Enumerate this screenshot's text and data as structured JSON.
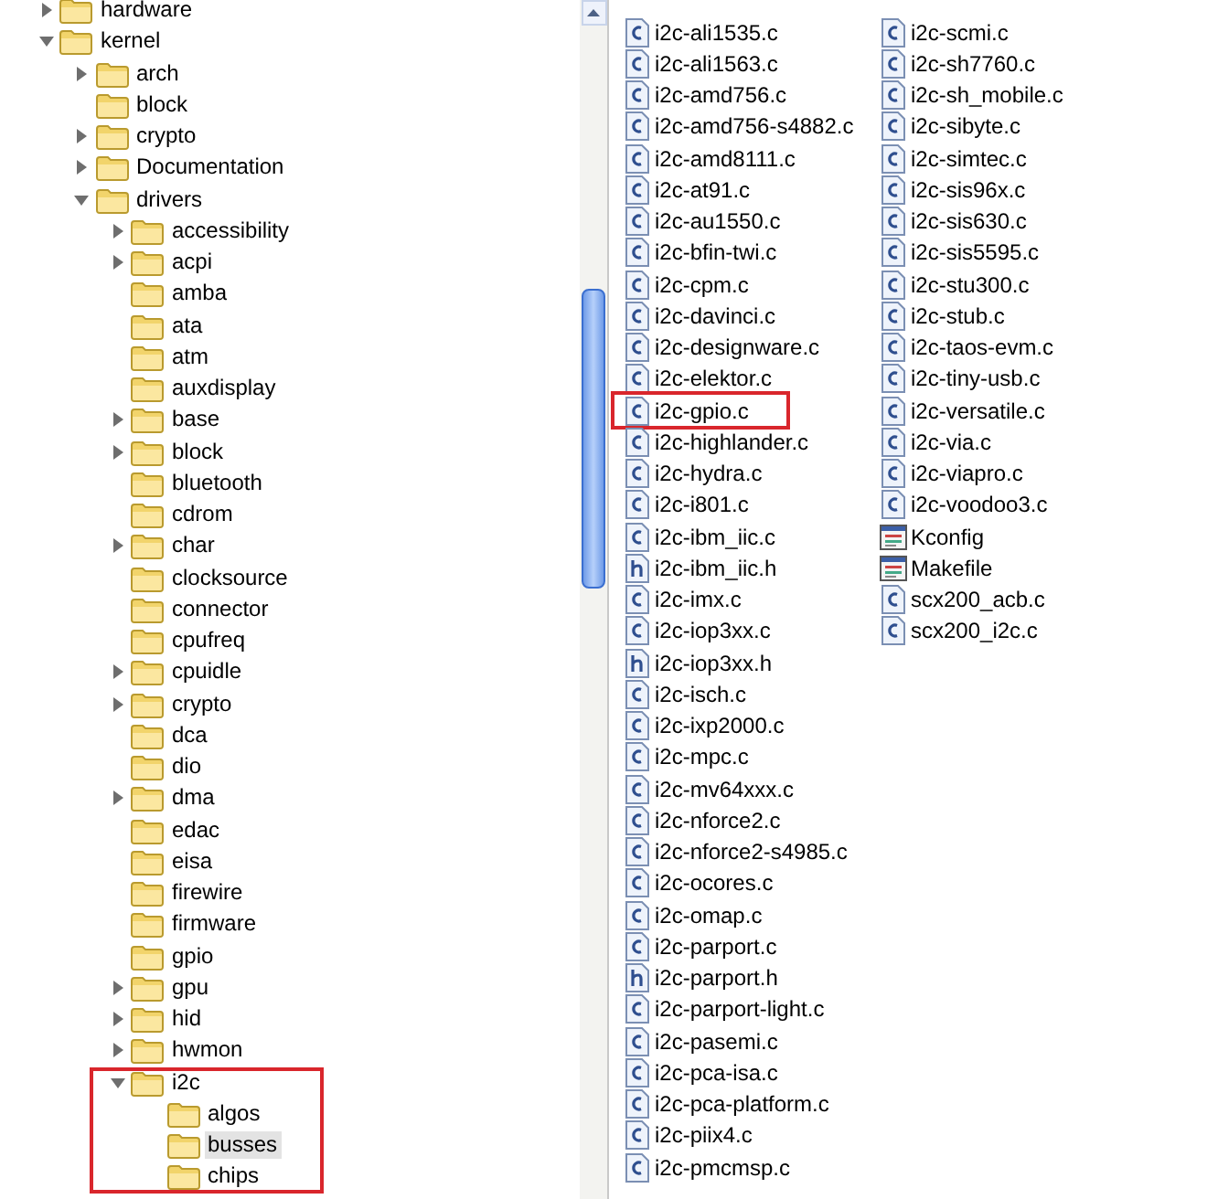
{
  "folder_tree": [
    {
      "label": "hardware",
      "expandable": true,
      "expanded": false,
      "selected": false,
      "outlined": false
    },
    {
      "label": "kernel",
      "expandable": true,
      "expanded": true,
      "selected": false,
      "outlined": false,
      "children": [
        {
          "label": "arch",
          "expandable": true,
          "expanded": false,
          "selected": false,
          "outlined": false
        },
        {
          "label": "block",
          "expandable": false,
          "selected": false,
          "outlined": false
        },
        {
          "label": "crypto",
          "expandable": true,
          "expanded": false,
          "selected": false,
          "outlined": false
        },
        {
          "label": "Documentation",
          "expandable": true,
          "expanded": false,
          "selected": false,
          "outlined": false
        },
        {
          "label": "drivers",
          "expandable": true,
          "expanded": true,
          "selected": false,
          "outlined": false,
          "children": [
            {
              "label": "accessibility",
              "expandable": true,
              "expanded": false,
              "selected": false,
              "outlined": false
            },
            {
              "label": "acpi",
              "expandable": true,
              "expanded": false,
              "selected": false,
              "outlined": false
            },
            {
              "label": "amba",
              "expandable": false,
              "selected": false,
              "outlined": false
            },
            {
              "label": "ata",
              "expandable": false,
              "selected": false,
              "outlined": false
            },
            {
              "label": "atm",
              "expandable": false,
              "selected": false,
              "outlined": false
            },
            {
              "label": "auxdisplay",
              "expandable": false,
              "selected": false,
              "outlined": false
            },
            {
              "label": "base",
              "expandable": true,
              "expanded": false,
              "selected": false,
              "outlined": false
            },
            {
              "label": "block",
              "expandable": true,
              "expanded": false,
              "selected": false,
              "outlined": false
            },
            {
              "label": "bluetooth",
              "expandable": false,
              "selected": false,
              "outlined": false
            },
            {
              "label": "cdrom",
              "expandable": false,
              "selected": false,
              "outlined": false
            },
            {
              "label": "char",
              "expandable": true,
              "expanded": false,
              "selected": false,
              "outlined": false
            },
            {
              "label": "clocksource",
              "expandable": false,
              "selected": false,
              "outlined": false
            },
            {
              "label": "connector",
              "expandable": false,
              "selected": false,
              "outlined": false
            },
            {
              "label": "cpufreq",
              "expandable": false,
              "selected": false,
              "outlined": false
            },
            {
              "label": "cpuidle",
              "expandable": true,
              "expanded": false,
              "selected": false,
              "outlined": false
            },
            {
              "label": "crypto",
              "expandable": true,
              "expanded": false,
              "selected": false,
              "outlined": false
            },
            {
              "label": "dca",
              "expandable": false,
              "selected": false,
              "outlined": false
            },
            {
              "label": "dio",
              "expandable": false,
              "selected": false,
              "outlined": false
            },
            {
              "label": "dma",
              "expandable": true,
              "expanded": false,
              "selected": false,
              "outlined": false
            },
            {
              "label": "edac",
              "expandable": false,
              "selected": false,
              "outlined": false
            },
            {
              "label": "eisa",
              "expandable": false,
              "selected": false,
              "outlined": false
            },
            {
              "label": "firewire",
              "expandable": false,
              "selected": false,
              "outlined": false
            },
            {
              "label": "firmware",
              "expandable": false,
              "selected": false,
              "outlined": false
            },
            {
              "label": "gpio",
              "expandable": false,
              "selected": false,
              "outlined": false
            },
            {
              "label": "gpu",
              "expandable": true,
              "expanded": false,
              "selected": false,
              "outlined": false
            },
            {
              "label": "hid",
              "expandable": true,
              "expanded": false,
              "selected": false,
              "outlined": false
            },
            {
              "label": "hwmon",
              "expandable": true,
              "expanded": false,
              "selected": false,
              "outlined": false
            },
            {
              "label": "i2c",
              "expandable": true,
              "expanded": true,
              "selected": false,
              "outlined": true,
              "children": [
                {
                  "label": "algos",
                  "expandable": false,
                  "selected": false,
                  "outlined": false
                },
                {
                  "label": "busses",
                  "expandable": false,
                  "selected": true,
                  "outlined": false
                },
                {
                  "label": "chips",
                  "expandable": false,
                  "selected": false,
                  "outlined": false
                }
              ]
            }
          ]
        }
      ]
    }
  ],
  "file_columns": [
    [
      {
        "name": "i2c-ali1535.c",
        "kind": "c",
        "outlined": false
      },
      {
        "name": "i2c-ali1563.c",
        "kind": "c",
        "outlined": false
      },
      {
        "name": "i2c-amd756.c",
        "kind": "c",
        "outlined": false
      },
      {
        "name": "i2c-amd756-s4882.c",
        "kind": "c",
        "outlined": false
      },
      {
        "name": "i2c-amd8111.c",
        "kind": "c",
        "outlined": false
      },
      {
        "name": "i2c-at91.c",
        "kind": "c",
        "outlined": false
      },
      {
        "name": "i2c-au1550.c",
        "kind": "c",
        "outlined": false
      },
      {
        "name": "i2c-bfin-twi.c",
        "kind": "c",
        "outlined": false
      },
      {
        "name": "i2c-cpm.c",
        "kind": "c",
        "outlined": false
      },
      {
        "name": "i2c-davinci.c",
        "kind": "c",
        "outlined": false
      },
      {
        "name": "i2c-designware.c",
        "kind": "c",
        "outlined": false
      },
      {
        "name": "i2c-elektor.c",
        "kind": "c",
        "outlined": false
      },
      {
        "name": "i2c-gpio.c",
        "kind": "c",
        "outlined": true
      },
      {
        "name": "i2c-highlander.c",
        "kind": "c",
        "outlined": false
      },
      {
        "name": "i2c-hydra.c",
        "kind": "c",
        "outlined": false
      },
      {
        "name": "i2c-i801.c",
        "kind": "c",
        "outlined": false
      },
      {
        "name": "i2c-ibm_iic.c",
        "kind": "c",
        "outlined": false
      },
      {
        "name": "i2c-ibm_iic.h",
        "kind": "h",
        "outlined": false
      },
      {
        "name": "i2c-imx.c",
        "kind": "c",
        "outlined": false
      },
      {
        "name": "i2c-iop3xx.c",
        "kind": "c",
        "outlined": false
      },
      {
        "name": "i2c-iop3xx.h",
        "kind": "h",
        "outlined": false
      },
      {
        "name": "i2c-isch.c",
        "kind": "c",
        "outlined": false
      },
      {
        "name": "i2c-ixp2000.c",
        "kind": "c",
        "outlined": false
      },
      {
        "name": "i2c-mpc.c",
        "kind": "c",
        "outlined": false
      },
      {
        "name": "i2c-mv64xxx.c",
        "kind": "c",
        "outlined": false
      },
      {
        "name": "i2c-nforce2.c",
        "kind": "c",
        "outlined": false
      },
      {
        "name": "i2c-nforce2-s4985.c",
        "kind": "c",
        "outlined": false
      },
      {
        "name": "i2c-ocores.c",
        "kind": "c",
        "outlined": false
      },
      {
        "name": "i2c-omap.c",
        "kind": "c",
        "outlined": false
      },
      {
        "name": "i2c-parport.c",
        "kind": "c",
        "outlined": false
      },
      {
        "name": "i2c-parport.h",
        "kind": "h",
        "outlined": false
      },
      {
        "name": "i2c-parport-light.c",
        "kind": "c",
        "outlined": false
      },
      {
        "name": "i2c-pasemi.c",
        "kind": "c",
        "outlined": false
      },
      {
        "name": "i2c-pca-isa.c",
        "kind": "c",
        "outlined": false
      },
      {
        "name": "i2c-pca-platform.c",
        "kind": "c",
        "outlined": false
      },
      {
        "name": "i2c-piix4.c",
        "kind": "c",
        "outlined": false
      },
      {
        "name": "i2c-pmcmsp.c",
        "kind": "c",
        "outlined": false
      }
    ],
    [
      {
        "name": "i2c-scmi.c",
        "kind": "c",
        "outlined": false
      },
      {
        "name": "i2c-sh7760.c",
        "kind": "c",
        "outlined": false
      },
      {
        "name": "i2c-sh_mobile.c",
        "kind": "c",
        "outlined": false
      },
      {
        "name": "i2c-sibyte.c",
        "kind": "c",
        "outlined": false
      },
      {
        "name": "i2c-simtec.c",
        "kind": "c",
        "outlined": false
      },
      {
        "name": "i2c-sis96x.c",
        "kind": "c",
        "outlined": false
      },
      {
        "name": "i2c-sis630.c",
        "kind": "c",
        "outlined": false
      },
      {
        "name": "i2c-sis5595.c",
        "kind": "c",
        "outlined": false
      },
      {
        "name": "i2c-stu300.c",
        "kind": "c",
        "outlined": false
      },
      {
        "name": "i2c-stub.c",
        "kind": "c",
        "outlined": false
      },
      {
        "name": "i2c-taos-evm.c",
        "kind": "c",
        "outlined": false
      },
      {
        "name": "i2c-tiny-usb.c",
        "kind": "c",
        "outlined": false
      },
      {
        "name": "i2c-versatile.c",
        "kind": "c",
        "outlined": false
      },
      {
        "name": "i2c-via.c",
        "kind": "c",
        "outlined": false
      },
      {
        "name": "i2c-viapro.c",
        "kind": "c",
        "outlined": false
      },
      {
        "name": "i2c-voodoo3.c",
        "kind": "c",
        "outlined": false
      },
      {
        "name": "Kconfig",
        "kind": "config",
        "outlined": false
      },
      {
        "name": "Makefile",
        "kind": "config",
        "outlined": false
      },
      {
        "name": "scx200_acb.c",
        "kind": "c",
        "outlined": false
      },
      {
        "name": "scx200_i2c.c",
        "kind": "c",
        "outlined": false
      }
    ]
  ]
}
